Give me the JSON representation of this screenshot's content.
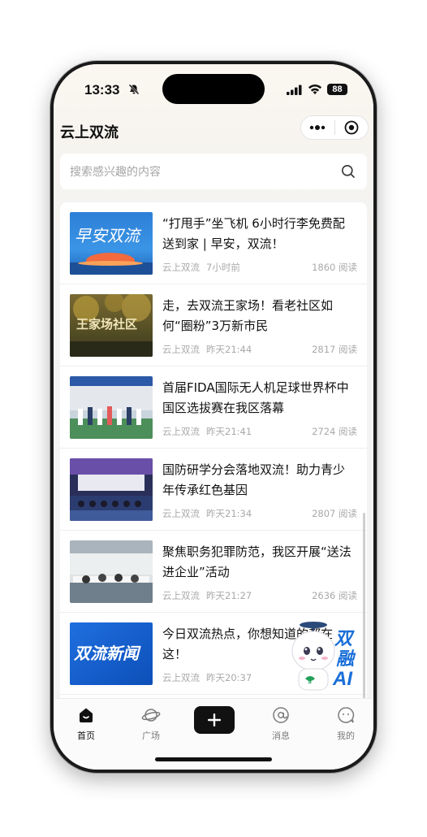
{
  "status_bar": {
    "time": "13:33",
    "battery": "88"
  },
  "header": {
    "title": "云上双流"
  },
  "search": {
    "placeholder": "搜索感兴趣的内容"
  },
  "feed": [
    {
      "title": "“打甩手”坐飞机 6小时行李免费配送到家 | 早安，双流！",
      "source": "云上双流",
      "time": "7小时前",
      "views": "1860 阅读",
      "thumb_text": "早安双流"
    },
    {
      "title": "走，去双流王家场！看老社区如何“圈粉”3万新市民",
      "source": "云上双流",
      "time": "昨天21:44",
      "views": "2817 阅读",
      "thumb_text": "王家场社区"
    },
    {
      "title": "首届FIDA国际无人机足球世界杯中国区选拔赛在我区落幕",
      "source": "云上双流",
      "time": "昨天21:41",
      "views": "2724 阅读"
    },
    {
      "title": "国防研学分会落地双流！助力青少年传承红色基因",
      "source": "云上双流",
      "time": "昨天21:34",
      "views": "2807 阅读"
    },
    {
      "title": "聚焦职务犯罪防范，我区开展“送法进企业”活动",
      "source": "云上双流",
      "time": "昨天21:27",
      "views": "2636 阅读"
    },
    {
      "title": "今日双流热点，你想知道的都在这！",
      "source": "云上双流",
      "time": "昨天20:37",
      "views": "",
      "thumb_text": "双流新闻"
    }
  ],
  "ai_badge": {
    "text1": "双",
    "text2": "融",
    "text3": "AI"
  },
  "tabbar": {
    "home": "首页",
    "square": "广场",
    "messages": "消息",
    "mine": "我的"
  },
  "colors": {
    "accent": "#111111",
    "muted": "#a9a9a9",
    "ai_blue": "#1a6fd8"
  }
}
